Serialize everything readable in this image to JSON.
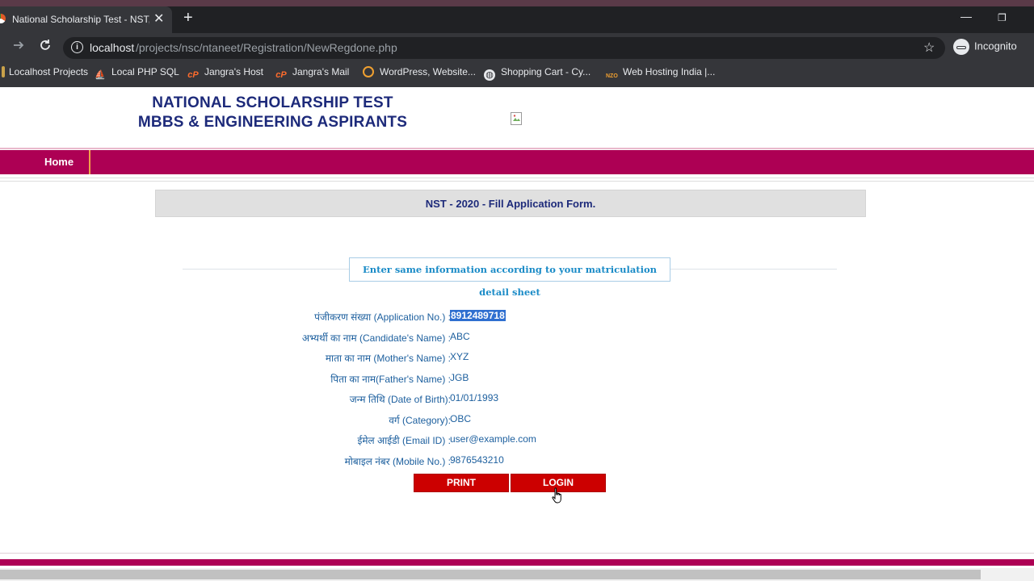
{
  "browser": {
    "tab_title": "National Scholarship Test - NST, ...",
    "tab_close": "✕",
    "new_tab": "+",
    "window_minimize": "—",
    "window_restore": "❐",
    "url_host": "localhost",
    "url_path": "/projects/nsc/ntaneet/Registration/NewRegdone.php",
    "incognito_label": "Incognito",
    "bookmarks": [
      {
        "label": "Localhost Projects",
        "icon": "bar-icon"
      },
      {
        "label": "Local PHP SQL",
        "icon": "phpmyadmin-icon"
      },
      {
        "label": "Jangra's Host",
        "icon": "cpanel-icon"
      },
      {
        "label": "Jangra's Mail",
        "icon": "cpanel-icon"
      },
      {
        "label": "WordPress, Website...",
        "icon": "ring-icon"
      },
      {
        "label": "Shopping Cart - Cy...",
        "icon": "globe-icon"
      },
      {
        "label": "Web Hosting India |...",
        "icon": "nzo-icon"
      }
    ]
  },
  "site": {
    "title_line1": "NATIONAL SCHOLARSHIP TEST",
    "title_line2": "MBBS & ENGINEERING ASPIRANTS",
    "nav_home": "Home"
  },
  "form": {
    "header": "NST - 2020 - Fill Application Form.",
    "notice": "Enter same information according to your matriculation detail sheet",
    "rows": [
      {
        "label": "पंजीकरण संख्या (Application No.) :",
        "value": "8912489718"
      },
      {
        "label": "अभ्यर्थी का नाम (Candidate's Name) :",
        "value": "ABC"
      },
      {
        "label": "माता का नाम (Mother's Name) :",
        "value": "XYZ"
      },
      {
        "label": "पिता का नाम(Father's Name) :",
        "value": "JGB"
      },
      {
        "label": "जन्म तिथि (Date of Birth):",
        "value": "01/01/1993"
      },
      {
        "label": "वर्ग (Category):",
        "value": "OBC"
      },
      {
        "label": "ईमेल आईडी (Email ID) :",
        "value": "user@example.com"
      },
      {
        "label": "मोबाइल नंबर (Mobile No.) :",
        "value": "9876543210"
      }
    ],
    "print_label": "PRINT",
    "login_label": "LOGIN"
  },
  "colors": {
    "brand_magenta": "#ad0054",
    "button_red": "#cc0000",
    "title_navy": "#1d2a7a",
    "label_blue": "#1c5f9e"
  }
}
